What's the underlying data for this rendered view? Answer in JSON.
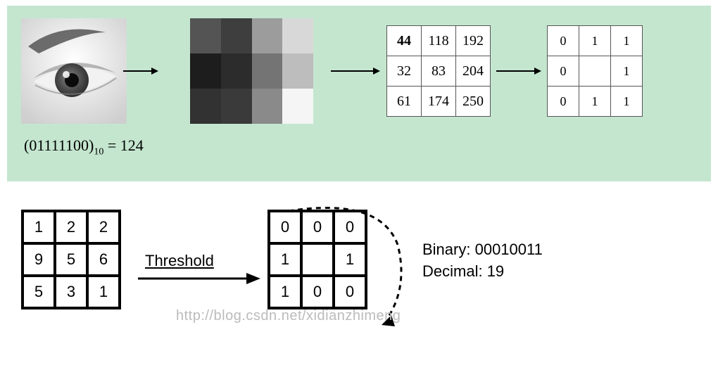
{
  "top": {
    "pixel_colors": [
      [
        "#545454",
        "#3e3e3e",
        "#9c9c9c",
        "#d8d8d8"
      ],
      [
        "#1d1d1d",
        "#2c2c2c",
        "#747474",
        "#bdbdbd"
      ],
      [
        "#323232",
        "#3a3a3a",
        "#8a8a8a",
        "#f5f5f5"
      ]
    ],
    "value_grid": [
      [
        "44",
        "118",
        "192"
      ],
      [
        "32",
        "83",
        "204"
      ],
      [
        "61",
        "174",
        "250"
      ]
    ],
    "binary_grid": [
      [
        "0",
        "1",
        "1"
      ],
      [
        "0",
        "",
        "1"
      ],
      [
        "0",
        "1",
        "1"
      ]
    ],
    "formula_bin": "(01111100)",
    "formula_base": "10",
    "formula_eq": " = 124"
  },
  "bottom": {
    "input_grid": [
      [
        "1",
        "2",
        "2"
      ],
      [
        "9",
        "5",
        "6"
      ],
      [
        "5",
        "3",
        "1"
      ]
    ],
    "threshold_label": "Threshold",
    "output_grid": [
      [
        "0",
        "0",
        "0"
      ],
      [
        "1",
        "",
        "1"
      ],
      [
        "1",
        "0",
        "0"
      ]
    ],
    "binary_label": "Binary: ",
    "binary_value": "00010011",
    "decimal_label": "Decimal: ",
    "decimal_value": "19",
    "watermark": "http://blog.csdn.net/xidianzhimeng"
  }
}
